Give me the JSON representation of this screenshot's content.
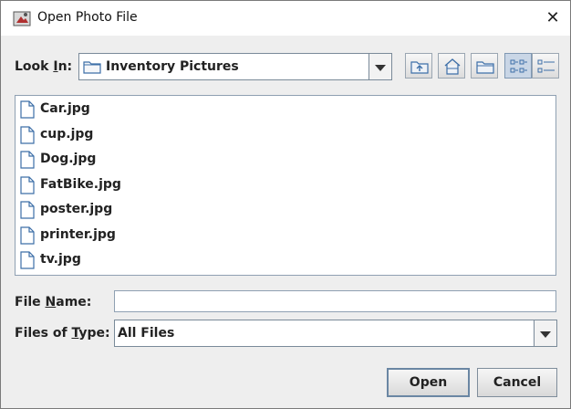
{
  "window": {
    "title": "Open Photo File",
    "close_glyph": "✕"
  },
  "look_in": {
    "label_prefix": "Look ",
    "label_mnemonic": "I",
    "label_suffix": "n:",
    "value": "Inventory Pictures",
    "icon": "folder-icon"
  },
  "toolbar": {
    "buttons": [
      {
        "name": "up-one-level-button",
        "icon": "folder-up-icon"
      },
      {
        "name": "home-button",
        "icon": "home-icon"
      },
      {
        "name": "new-folder-button",
        "icon": "new-folder-icon"
      },
      {
        "name": "list-view-button",
        "icon": "list-view-icon",
        "selected": true
      },
      {
        "name": "details-view-button",
        "icon": "details-view-icon",
        "selected": false
      }
    ]
  },
  "files": [
    {
      "name": "Car.jpg",
      "icon": "file-icon"
    },
    {
      "name": "cup.jpg",
      "icon": "file-icon"
    },
    {
      "name": "Dog.jpg",
      "icon": "file-icon"
    },
    {
      "name": "FatBike.jpg",
      "icon": "file-icon"
    },
    {
      "name": "poster.jpg",
      "icon": "file-icon"
    },
    {
      "name": "printer.jpg",
      "icon": "file-icon"
    },
    {
      "name": "tv.jpg",
      "icon": "file-icon"
    }
  ],
  "file_name": {
    "label_prefix": "File ",
    "label_mnemonic": "N",
    "label_suffix": "ame:",
    "value": ""
  },
  "file_type": {
    "label_prefix": "Files of ",
    "label_mnemonic": "T",
    "label_suffix": "ype:",
    "value": "All Files"
  },
  "buttons": {
    "open": "Open",
    "cancel": "Cancel"
  },
  "colors": {
    "window_bg": "#eeeeee",
    "list_bg": "#ffffff",
    "icon_blue": "#3d6fa8"
  }
}
